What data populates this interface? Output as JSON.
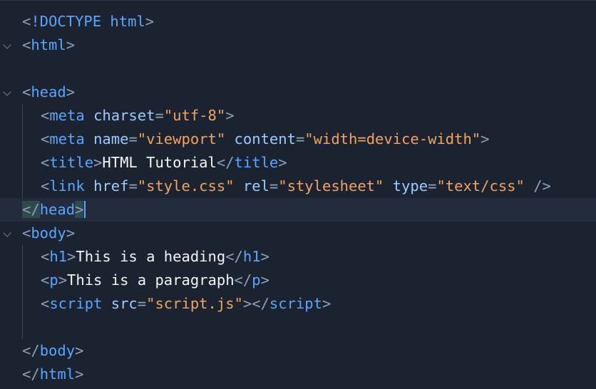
{
  "editor": {
    "language": "html",
    "colors": {
      "background": "#1b2331",
      "active_line": "#222c3c",
      "tag": "#58a6ff",
      "attribute": "#9ecbff",
      "string": "#f0a45d",
      "text": "#f2f4f8",
      "punctuation": "#8ea0b4",
      "cursor": "#58a6ff"
    },
    "lines": [
      {
        "id": "l1",
        "fold": false,
        "indent": 0,
        "tokens": [
          {
            "t": "punct",
            "v": "<"
          },
          {
            "t": "doc",
            "v": "!DOCTYPE html"
          },
          {
            "t": "punct",
            "v": ">"
          }
        ]
      },
      {
        "id": "l2",
        "fold": true,
        "indent": 0,
        "tokens": [
          {
            "t": "punct",
            "v": "<"
          },
          {
            "t": "tag",
            "v": "html"
          },
          {
            "t": "punct",
            "v": ">"
          }
        ]
      },
      {
        "id": "l3",
        "fold": false,
        "indent": 0,
        "tokens": []
      },
      {
        "id": "l4",
        "fold": true,
        "indent": 0,
        "tokens": [
          {
            "t": "punct",
            "v": "<"
          },
          {
            "t": "tag",
            "v": "head"
          },
          {
            "t": "punct",
            "v": ">"
          }
        ]
      },
      {
        "id": "l5",
        "fold": false,
        "indent": 1,
        "tokens": [
          {
            "t": "punct",
            "v": "<"
          },
          {
            "t": "tag",
            "v": "meta"
          },
          {
            "t": "text",
            "v": " "
          },
          {
            "t": "attr",
            "v": "charset"
          },
          {
            "t": "punct",
            "v": "="
          },
          {
            "t": "str",
            "v": "\"utf-8\""
          },
          {
            "t": "punct",
            "v": ">"
          }
        ]
      },
      {
        "id": "l6",
        "fold": false,
        "indent": 1,
        "tokens": [
          {
            "t": "punct",
            "v": "<"
          },
          {
            "t": "tag",
            "v": "meta"
          },
          {
            "t": "text",
            "v": " "
          },
          {
            "t": "attr",
            "v": "name"
          },
          {
            "t": "punct",
            "v": "="
          },
          {
            "t": "str",
            "v": "\"viewport\""
          },
          {
            "t": "text",
            "v": " "
          },
          {
            "t": "attr",
            "v": "content"
          },
          {
            "t": "punct",
            "v": "="
          },
          {
            "t": "str",
            "v": "\"width=device-width\""
          },
          {
            "t": "punct",
            "v": ">"
          }
        ]
      },
      {
        "id": "l7",
        "fold": false,
        "indent": 1,
        "tokens": [
          {
            "t": "punct",
            "v": "<"
          },
          {
            "t": "tag",
            "v": "title"
          },
          {
            "t": "punct",
            "v": ">"
          },
          {
            "t": "text",
            "v": "HTML Tutorial"
          },
          {
            "t": "punct",
            "v": "</"
          },
          {
            "t": "tag",
            "v": "title"
          },
          {
            "t": "punct",
            "v": ">"
          }
        ]
      },
      {
        "id": "l8",
        "fold": false,
        "indent": 1,
        "tokens": [
          {
            "t": "punct",
            "v": "<"
          },
          {
            "t": "tag",
            "v": "link"
          },
          {
            "t": "text",
            "v": " "
          },
          {
            "t": "attr",
            "v": "href"
          },
          {
            "t": "punct",
            "v": "="
          },
          {
            "t": "str",
            "v": "\"style.css\""
          },
          {
            "t": "text",
            "v": " "
          },
          {
            "t": "attr",
            "v": "rel"
          },
          {
            "t": "punct",
            "v": "="
          },
          {
            "t": "str",
            "v": "\"stylesheet\""
          },
          {
            "t": "text",
            "v": " "
          },
          {
            "t": "attr",
            "v": "type"
          },
          {
            "t": "punct",
            "v": "="
          },
          {
            "t": "str",
            "v": "\"text/css\""
          },
          {
            "t": "text",
            "v": " "
          },
          {
            "t": "punct",
            "v": "/>"
          }
        ]
      },
      {
        "id": "l9",
        "fold": false,
        "indent": 0,
        "active": true,
        "tokens": [
          {
            "t": "punct",
            "v": "</",
            "hl": true
          },
          {
            "t": "tag",
            "v": "head"
          },
          {
            "t": "punct",
            "v": ">",
            "hl": true
          },
          {
            "t": "cursor",
            "v": ""
          }
        ]
      },
      {
        "id": "l10",
        "fold": true,
        "indent": 0,
        "tokens": [
          {
            "t": "punct",
            "v": "<"
          },
          {
            "t": "tag",
            "v": "body"
          },
          {
            "t": "punct",
            "v": ">"
          }
        ]
      },
      {
        "id": "l11",
        "fold": false,
        "indent": 1,
        "tokens": [
          {
            "t": "punct",
            "v": "<"
          },
          {
            "t": "tag",
            "v": "h1"
          },
          {
            "t": "punct",
            "v": ">"
          },
          {
            "t": "text",
            "v": "This is a heading"
          },
          {
            "t": "punct",
            "v": "</"
          },
          {
            "t": "tag",
            "v": "h1"
          },
          {
            "t": "punct",
            "v": ">"
          }
        ]
      },
      {
        "id": "l12",
        "fold": false,
        "indent": 1,
        "tokens": [
          {
            "t": "punct",
            "v": "<"
          },
          {
            "t": "tag",
            "v": "p"
          },
          {
            "t": "punct",
            "v": ">"
          },
          {
            "t": "text",
            "v": "This is a paragraph"
          },
          {
            "t": "punct",
            "v": "</"
          },
          {
            "t": "tag",
            "v": "p"
          },
          {
            "t": "punct",
            "v": ">"
          }
        ]
      },
      {
        "id": "l13",
        "fold": false,
        "indent": 1,
        "tokens": [
          {
            "t": "punct",
            "v": "<"
          },
          {
            "t": "tag",
            "v": "script"
          },
          {
            "t": "text",
            "v": " "
          },
          {
            "t": "attr",
            "v": "src"
          },
          {
            "t": "punct",
            "v": "="
          },
          {
            "t": "str",
            "v": "\"script.js\""
          },
          {
            "t": "punct",
            "v": ">"
          },
          {
            "t": "punct",
            "v": "</"
          },
          {
            "t": "tag",
            "v": "script"
          },
          {
            "t": "punct",
            "v": ">"
          }
        ]
      },
      {
        "id": "l14",
        "fold": false,
        "indent": 1,
        "tokens": []
      },
      {
        "id": "l15",
        "fold": false,
        "indent": 0,
        "tokens": [
          {
            "t": "punct",
            "v": "</"
          },
          {
            "t": "tag",
            "v": "body"
          },
          {
            "t": "punct",
            "v": ">"
          }
        ]
      },
      {
        "id": "l16",
        "fold": false,
        "indent": 0,
        "tokens": [
          {
            "t": "punct",
            "v": "</"
          },
          {
            "t": "tag",
            "v": "html"
          },
          {
            "t": "punct",
            "v": ">"
          }
        ]
      }
    ]
  }
}
